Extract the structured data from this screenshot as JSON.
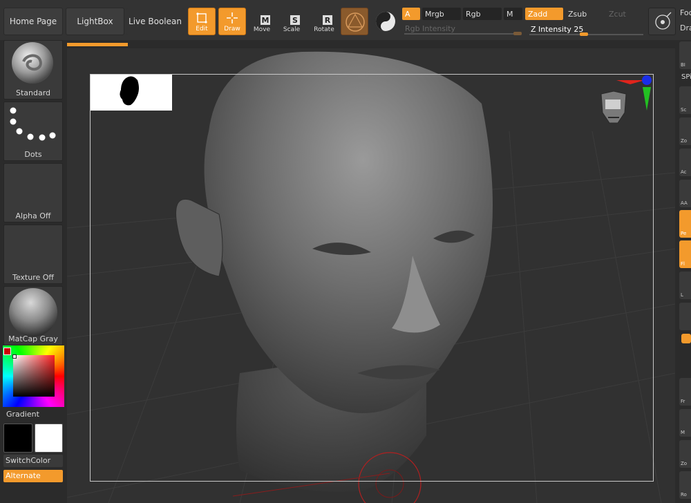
{
  "nav": {
    "home": "Home Page",
    "lightbox": "LightBox",
    "live_boolean": "Live Boolean"
  },
  "tools": {
    "edit": "Edit",
    "draw": "Draw",
    "move": "Move",
    "scale": "Scale",
    "rotate": "Rotate",
    "move_key": "M",
    "scale_key": "S",
    "rotate_key": "R"
  },
  "modes": {
    "a": "A",
    "mrgb": "Mrgb",
    "rgb": "Rgb",
    "m": "M",
    "zadd": "Zadd",
    "zsub": "Zsub",
    "zcut": "Zcut",
    "rgb_intensity": "Rgb Intensity",
    "z_intensity_label": "Z Intensity",
    "z_intensity_value": "25"
  },
  "right_top": {
    "focal": "Foc",
    "draw": "Dra"
  },
  "right_shelf": [
    "BI",
    "SPi",
    "Sc",
    "Zo",
    "Ac",
    "AA",
    "Pe",
    "Fl",
    "L",
    "",
    "",
    "Fr",
    "M",
    "Zo",
    "Ro"
  ],
  "left_shelf": {
    "brush": "Standard",
    "stroke": "Dots",
    "alpha": "Alpha Off",
    "texture": "Texture Off",
    "material": "MatCap Gray",
    "gradient": "Gradient",
    "switch_color": "SwitchColor",
    "alternate": "Alternate"
  },
  "colors": {
    "accent": "#f39a2c",
    "main_color": "#000000",
    "secondary_color": "#ffffff",
    "axis_x": "#e0241c",
    "axis_y": "#22c022",
    "axis_z": "#1a2ee8"
  }
}
